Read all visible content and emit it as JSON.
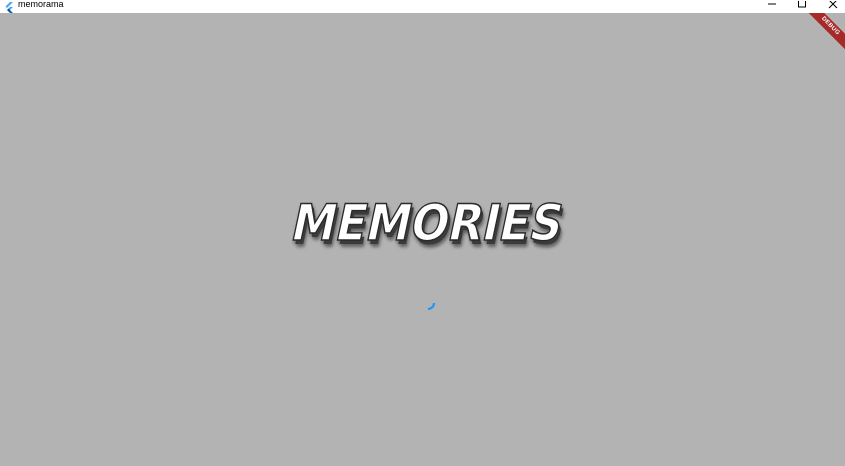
{
  "window": {
    "title": "memorama",
    "app_icon": "flutter-icon",
    "controls": {
      "minimize_icon": "minimize-icon",
      "maximize_icon": "maximize-icon",
      "close_icon": "close-icon"
    }
  },
  "splash": {
    "logo_text": "MEMORIES",
    "background_color": "#b3b3b3",
    "spinner_color": "#2196f3",
    "spinner_icon": "loading-spinner-icon"
  },
  "debug_banner": {
    "label": "DEBUG",
    "color": "#a62a2a"
  }
}
